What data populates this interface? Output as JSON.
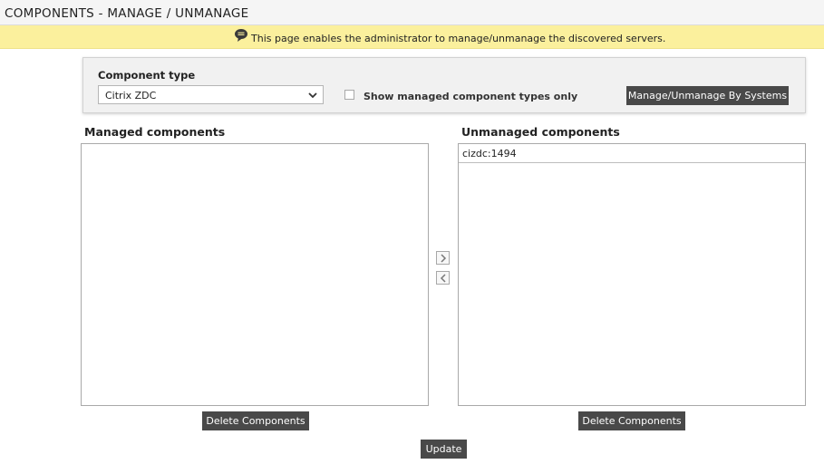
{
  "header": {
    "title": "COMPONENTS - MANAGE / UNMANAGE"
  },
  "info_bar": {
    "icon": "speech-bubble-icon",
    "message": "This page enables the administrator to manage/unmanage the discovered servers."
  },
  "filter": {
    "component_type_label": "Component type",
    "component_type_value": "Citrix ZDC",
    "show_managed_only_label": "Show managed component types only",
    "show_managed_only_checked": false,
    "by_systems_button": "Manage/Unmanage By Systems"
  },
  "managed": {
    "heading": "Managed components",
    "items": [],
    "delete_button": "Delete Components"
  },
  "unmanaged": {
    "heading": "Unmanaged components",
    "items": [
      "cizdc:1494"
    ],
    "delete_button": "Delete Components"
  },
  "transfer": {
    "move_right_icon": "chevron-right-icon",
    "move_left_icon": "chevron-left-icon"
  },
  "footer": {
    "update_button": "Update"
  },
  "colors": {
    "info_bar_bg": "#fbf09d",
    "button_bg": "#494949",
    "panel_bg": "#f1f1f1"
  }
}
